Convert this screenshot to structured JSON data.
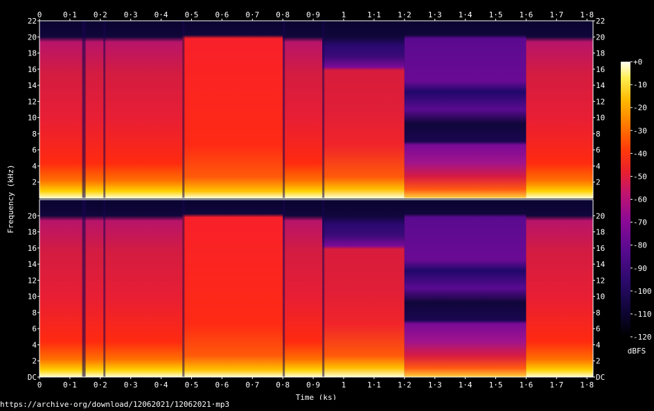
{
  "chart_data": {
    "type": "heatmap",
    "subtype": "spectrogram",
    "channels": 2,
    "xlabel": "Time (ks)",
    "ylabel": "Frequency (kHz)",
    "xlim": [
      0,
      1.82
    ],
    "ylim": [
      0,
      22
    ],
    "x_ticks": [
      {
        "v": 0,
        "label": "0"
      },
      {
        "v": 0.1,
        "label": "0·1"
      },
      {
        "v": 0.2,
        "label": "0·2"
      },
      {
        "v": 0.3,
        "label": "0·3"
      },
      {
        "v": 0.4,
        "label": "0·4"
      },
      {
        "v": 0.5,
        "label": "0·5"
      },
      {
        "v": 0.6,
        "label": "0·6"
      },
      {
        "v": 0.7,
        "label": "0·7"
      },
      {
        "v": 0.8,
        "label": "0·8"
      },
      {
        "v": 0.9,
        "label": "0·9"
      },
      {
        "v": 1.0,
        "label": "1"
      },
      {
        "v": 1.1,
        "label": "1·1"
      },
      {
        "v": 1.2,
        "label": "1·2"
      },
      {
        "v": 1.3,
        "label": "1·3"
      },
      {
        "v": 1.4,
        "label": "1·4"
      },
      {
        "v": 1.5,
        "label": "1·5"
      },
      {
        "v": 1.6,
        "label": "1·6"
      },
      {
        "v": 1.7,
        "label": "1·7"
      },
      {
        "v": 1.8,
        "label": "1·8"
      }
    ],
    "y_ticks_top": [
      "2",
      "4",
      "6",
      "8",
      "10",
      "12",
      "14",
      "16",
      "18",
      "20",
      "22"
    ],
    "y_ticks_bottom": [
      "DC",
      "2",
      "4",
      "6",
      "8",
      "10",
      "12",
      "14",
      "16",
      "18",
      "20"
    ],
    "colorbar": {
      "label": "dBFS",
      "range": [
        -120,
        0
      ],
      "ticks": [
        "+0",
        "-10",
        "-20",
        "-30",
        "-40",
        "-50",
        "-60",
        "-70",
        "-80",
        "-90",
        "-100",
        "-110",
        "-120"
      ]
    },
    "segments": [
      {
        "t0": 0.0,
        "t1": 0.47,
        "level": "loud"
      },
      {
        "t0": 0.47,
        "t1": 0.8,
        "level": "very loud"
      },
      {
        "t0": 0.8,
        "t1": 0.93,
        "level": "loud"
      },
      {
        "t0": 0.93,
        "t1": 1.2,
        "level": "loud, cutoff ~16 kHz"
      },
      {
        "t0": 1.2,
        "t1": 1.6,
        "level": "quiet"
      },
      {
        "t0": 1.6,
        "t1": 1.82,
        "level": "loud"
      }
    ],
    "colors": [
      "#000000",
      "#10063a",
      "#3a0a78",
      "#7a0a96",
      "#b0127a",
      "#e0203a",
      "#ff2a10",
      "#ff6a00",
      "#ffb000",
      "#ffe840",
      "#fffff0"
    ]
  },
  "source_url": "https://archive·org/download/12062021/12062021·mp3"
}
